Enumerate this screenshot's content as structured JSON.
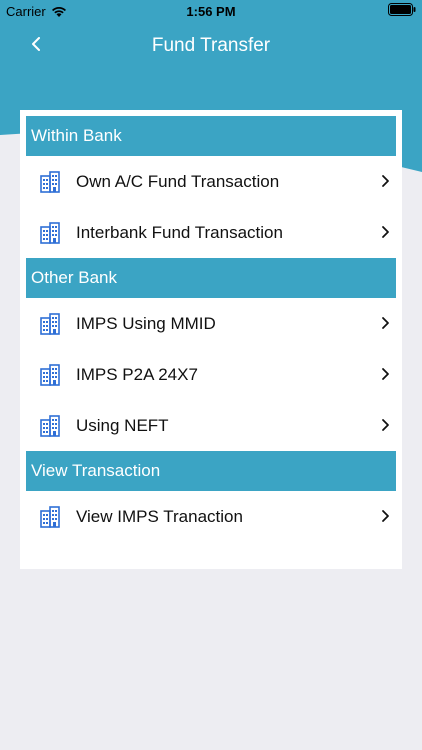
{
  "status_bar": {
    "carrier": "Carrier",
    "time": "1:56 PM"
  },
  "nav": {
    "title": "Fund Transfer"
  },
  "colors": {
    "header_bg": "#3ba4c4",
    "section_bg": "#3ba4c4",
    "page_bg": "#ededf2",
    "icon": "#2f6fd6"
  },
  "sections": [
    {
      "title": "Within Bank",
      "items": [
        {
          "label": "Own A/C Fund Transaction",
          "icon": "bank-building-icon"
        },
        {
          "label": "Interbank Fund Transaction",
          "icon": "bank-building-icon"
        }
      ]
    },
    {
      "title": "Other Bank",
      "items": [
        {
          "label": "IMPS Using MMID",
          "icon": "bank-building-icon"
        },
        {
          "label": "IMPS P2A 24X7",
          "icon": "bank-building-icon"
        },
        {
          "label": "Using NEFT",
          "icon": "bank-building-icon"
        }
      ]
    },
    {
      "title": "View Transaction",
      "items": [
        {
          "label": "View IMPS Tranaction",
          "icon": "bank-building-icon"
        }
      ]
    }
  ]
}
